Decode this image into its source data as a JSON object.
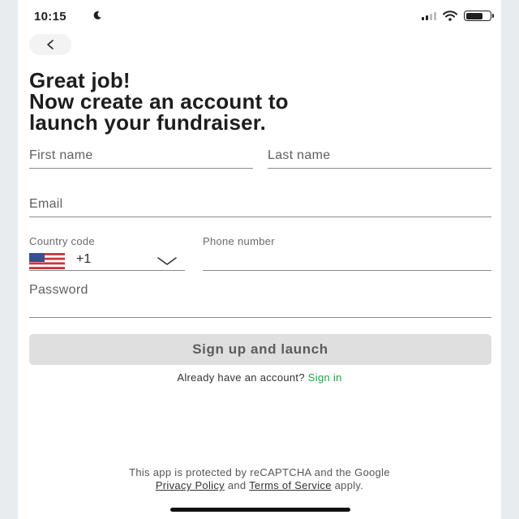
{
  "status_bar": {
    "time": "10:15",
    "icons": [
      "moon-icon",
      "signal-icon",
      "wifi-icon",
      "battery-icon"
    ]
  },
  "back_button": {
    "icon": "chevron-left-icon"
  },
  "headline": {
    "line1": "Great job!",
    "line2": "Now create an account to",
    "line3": "launch your fundraiser."
  },
  "form": {
    "first_name": {
      "label": "First name",
      "value": ""
    },
    "last_name": {
      "label": "Last name",
      "value": ""
    },
    "email": {
      "label": "Email",
      "value": ""
    },
    "country_code": {
      "label": "Country code",
      "dial_code": "+1",
      "flag": "us-flag-icon"
    },
    "phone": {
      "label": "Phone number",
      "value": ""
    },
    "password": {
      "label": "Password",
      "value": ""
    }
  },
  "signup_button": {
    "label": "Sign up and launch"
  },
  "signin": {
    "prompt": "Already have an account?",
    "link": "Sign in",
    "link_color": "#1fa24a"
  },
  "recaptcha": {
    "line1": "This app is protected by reCAPTCHA and the Google",
    "privacy": "Privacy Policy",
    "and": "and",
    "terms": "Terms of Service",
    "apply": "apply."
  }
}
